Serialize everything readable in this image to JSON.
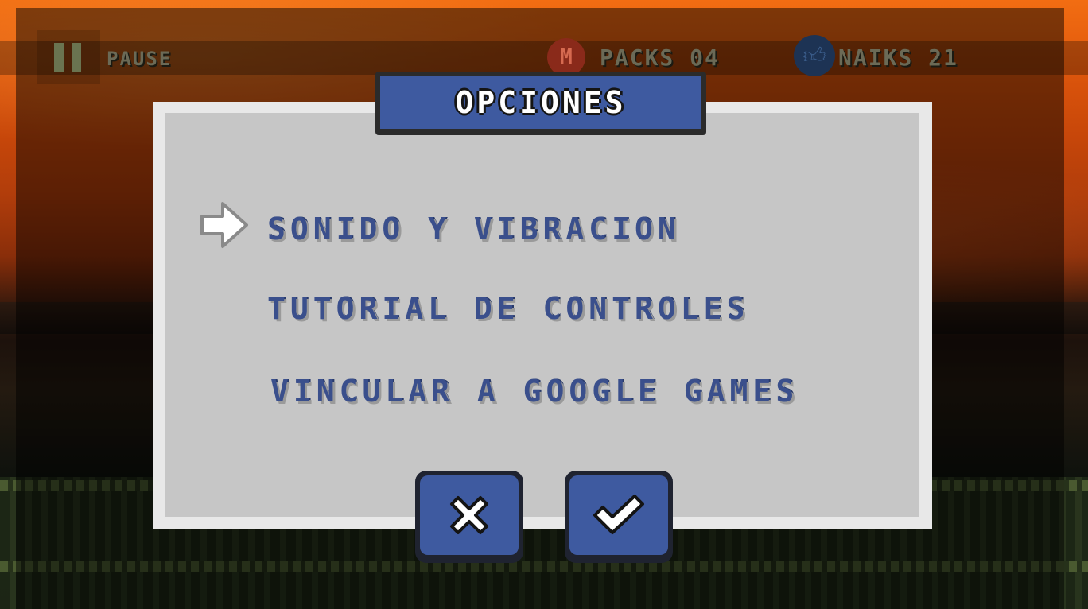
{
  "hud": {
    "pause_label": "PAUSE",
    "coin_letter": "M",
    "packs_label": "PACKS 04",
    "naiks_label": "NAIKS 21"
  },
  "dialog": {
    "title": "OPCIONES",
    "items": [
      {
        "label": "SONIDO Y VIBRACION",
        "selected": true
      },
      {
        "label": "TUTORIAL DE CONTROLES",
        "selected": false
      },
      {
        "label": "VINCULAR A GOOGLE GAMES",
        "selected": false
      }
    ],
    "buttons": {
      "cancel_icon": "x-icon",
      "confirm_icon": "checkmark-icon"
    }
  },
  "colors": {
    "panel_blue": "#3e5aa0",
    "panel_gray": "#c6c6c6",
    "text_blue": "#3a4f8c"
  }
}
